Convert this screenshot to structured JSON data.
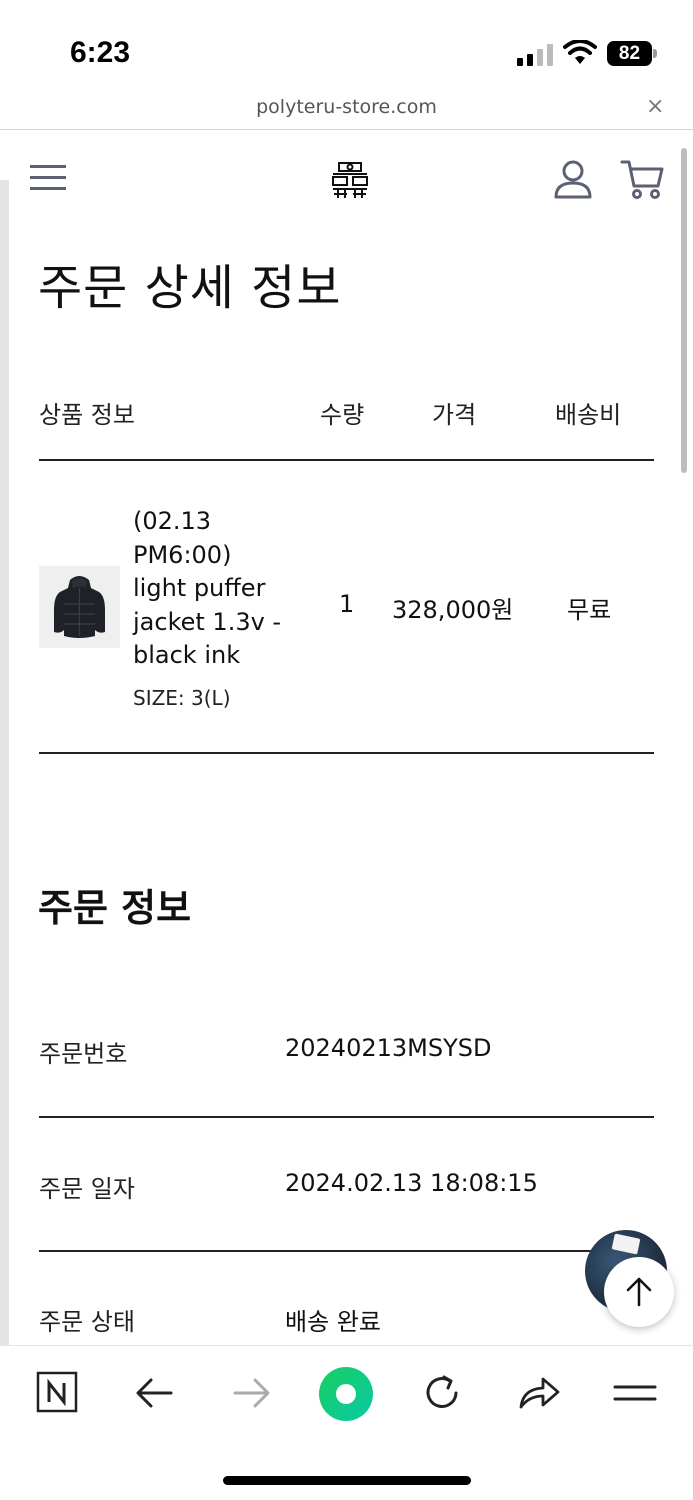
{
  "status_bar": {
    "time": "6:23",
    "battery": "82"
  },
  "browser": {
    "url": "polyteru-store.com",
    "close_label": "×"
  },
  "header": {
    "menu_icon": "hamburger-menu-icon",
    "logo_icon": "polyteru-logo-icon",
    "account_icon": "user-icon",
    "cart_icon": "cart-icon"
  },
  "page": {
    "title": "주문 상세 정보"
  },
  "product_table": {
    "columns": [
      "상품 정보",
      "수량",
      "가격",
      "배송비"
    ],
    "rows": [
      {
        "name_lines": [
          "(02.13",
          "PM6:00)",
          "light puffer",
          "jacket 1.3v -",
          "black ink"
        ],
        "option": "SIZE: 3(L)",
        "quantity": "1",
        "price": "328,000원",
        "shipping": "무료"
      }
    ]
  },
  "order_info": {
    "title": "주문 정보",
    "rows": [
      {
        "label": "주문번호",
        "value": "20240213MSYSD"
      },
      {
        "label": "주문 일자",
        "value": "2024.02.13 18:08:15"
      },
      {
        "label": "주문 상태",
        "value": "배송 완료"
      }
    ]
  },
  "bottom_bar": {
    "icons": [
      "naver-home-icon",
      "back-arrow-icon",
      "forward-arrow-icon",
      "green-dot-icon",
      "reload-icon",
      "share-icon",
      "menu-icon"
    ]
  },
  "colors": {
    "icon_slate": "#5b6173",
    "green": "#19ce60",
    "text": "#111111"
  }
}
